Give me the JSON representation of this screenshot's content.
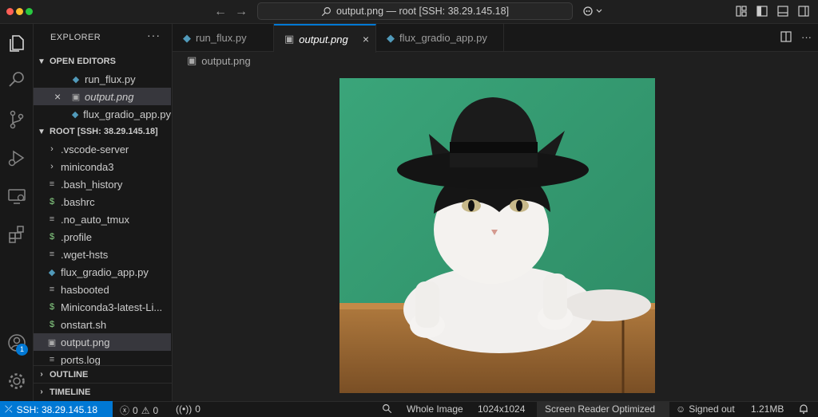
{
  "titlebar": {
    "title": "output.png — root [SSH: 38.29.145.18]"
  },
  "activity": {
    "accounts_badge": "1"
  },
  "sidebar": {
    "title": "EXPLORER",
    "more": "···",
    "open_editors": {
      "header": "OPEN EDITORS",
      "items": [
        {
          "label": "run_flux.py",
          "icon": "python-file-icon"
        },
        {
          "label": "output.png",
          "icon": "image-file-icon",
          "close": "×"
        },
        {
          "label": "flux_gradio_app.py",
          "icon": "python-file-icon"
        }
      ]
    },
    "root": {
      "header": "ROOT [SSH: 38.29.145.18]",
      "items": [
        {
          "label": ".vscode-server",
          "icon": "chevron-right-icon"
        },
        {
          "label": "miniconda3",
          "icon": "chevron-right-icon"
        },
        {
          "label": ".bash_history",
          "icon": "lines-file-icon"
        },
        {
          "label": ".bashrc",
          "icon": "shell-file-icon"
        },
        {
          "label": ".no_auto_tmux",
          "icon": "lines-file-icon"
        },
        {
          "label": ".profile",
          "icon": "shell-file-icon"
        },
        {
          "label": ".wget-hsts",
          "icon": "lines-file-icon"
        },
        {
          "label": "flux_gradio_app.py",
          "icon": "python-file-icon"
        },
        {
          "label": "hasbooted",
          "icon": "lines-file-icon"
        },
        {
          "label": "Miniconda3-latest-Li...",
          "icon": "shell-file-icon"
        },
        {
          "label": "onstart.sh",
          "icon": "shell-file-icon"
        },
        {
          "label": "output.png",
          "icon": "image-file-icon"
        },
        {
          "label": "ports.log",
          "icon": "lines-file-icon"
        }
      ]
    },
    "outline": "OUTLINE",
    "timeline": "TIMELINE"
  },
  "editor": {
    "tabs": [
      {
        "label": "run_flux.py"
      },
      {
        "label": "output.png"
      },
      {
        "label": "flux_gradio_app.py"
      }
    ],
    "breadcrumb": "output.png"
  },
  "statusbar": {
    "remote": "SSH: 38.29.145.18",
    "errors": "0",
    "warnings": "0",
    "ports": "0",
    "zoom": "Whole Image",
    "dimensions": "1024x1024",
    "screen_reader": "Screen Reader Optimized",
    "account": "Signed out",
    "size": "1.21MB"
  },
  "colors": {
    "accent": "#0078d4",
    "background": "#1f1f1f",
    "sidebar": "#181818"
  }
}
